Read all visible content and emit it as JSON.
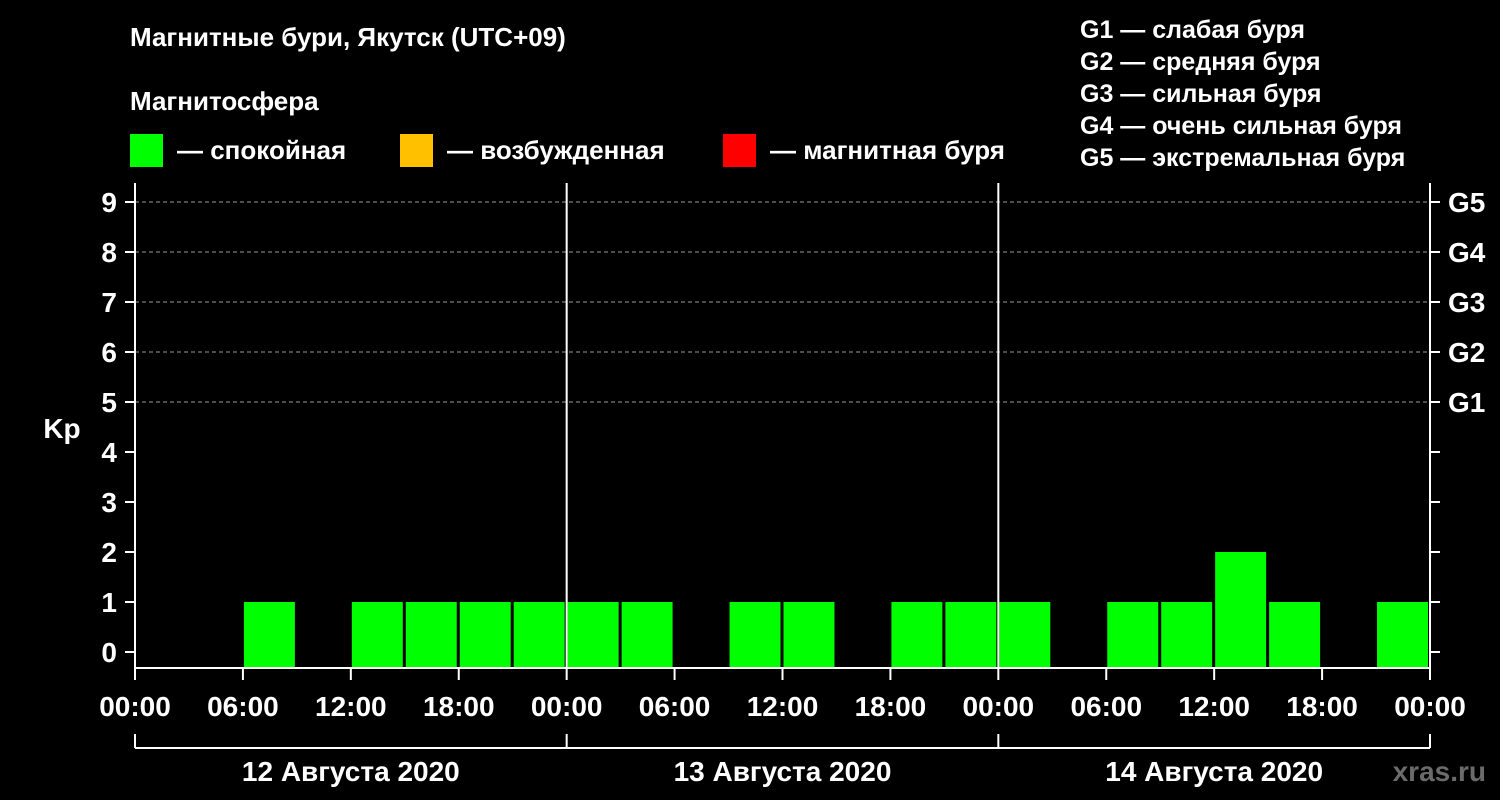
{
  "header": {
    "title": "Магнитные бури, Якутск (UTC+09)",
    "subtitle": "Магнитосфера"
  },
  "legend": [
    {
      "label": "— спокойная",
      "color": "#00ff00"
    },
    {
      "label": "— возбужденная",
      "color": "#ffc000"
    },
    {
      "label": "— магнитная буря",
      "color": "#ff0000"
    }
  ],
  "g_legend": [
    "G1 — слабая буря",
    "G2 — средняя буря",
    "G3 — сильная буря",
    "G4 — очень сильная буря",
    "G5 — экстремальная буря"
  ],
  "watermark": "xras.ru",
  "chart_data": {
    "type": "bar",
    "ylabel": "Kp",
    "ylim": [
      0,
      9
    ],
    "yticks": [
      "0",
      "1",
      "2",
      "3",
      "4",
      "5",
      "6",
      "7",
      "8",
      "9"
    ],
    "right_ticks": [
      {
        "kp": 5,
        "label": "G1"
      },
      {
        "kp": 6,
        "label": "G2"
      },
      {
        "kp": 7,
        "label": "G3"
      },
      {
        "kp": 8,
        "label": "G4"
      },
      {
        "kp": 9,
        "label": "G5"
      }
    ],
    "x_tick_labels": [
      "00:00",
      "06:00",
      "12:00",
      "18:00",
      "00:00",
      "06:00",
      "12:00",
      "18:00",
      "00:00",
      "06:00",
      "12:00",
      "18:00",
      "00:00"
    ],
    "days": [
      "12 Августа 2020",
      "13 Августа 2020",
      "14 Августа 2020"
    ],
    "interval_hours": 3,
    "grid": "dashed at Kp 5-9",
    "values": [
      0,
      0,
      1,
      0,
      1,
      1,
      1,
      1,
      1,
      1,
      0,
      1,
      1,
      0,
      1,
      1,
      1,
      0,
      1,
      1,
      2,
      1,
      0,
      1
    ],
    "colors": {
      "quiet": "#00ff00",
      "disturbed": "#ffc000",
      "storm": "#ff0000"
    }
  }
}
